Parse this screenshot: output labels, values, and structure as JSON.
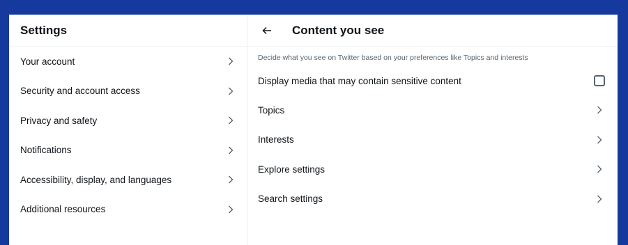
{
  "sidebar": {
    "title": "Settings",
    "items": [
      {
        "label": "Your account"
      },
      {
        "label": "Security and account access"
      },
      {
        "label": "Privacy and safety"
      },
      {
        "label": "Notifications"
      },
      {
        "label": "Accessibility, display, and languages"
      },
      {
        "label": "Additional resources"
      }
    ]
  },
  "main": {
    "title": "Content you see",
    "description": "Decide what you see on Twitter based on your preferences like Topics and interests",
    "sensitive_media": {
      "label": "Display media that may contain sensitive content",
      "checked": false
    },
    "rows": [
      {
        "label": "Topics"
      },
      {
        "label": "Interests"
      },
      {
        "label": "Explore settings"
      },
      {
        "label": "Search settings"
      }
    ]
  },
  "icons": {
    "back": "arrow-left-icon",
    "chevron": "chevron-right-icon",
    "checkbox": "checkbox-unchecked"
  },
  "colors": {
    "background": "#16399e",
    "panel": "#ffffff",
    "text": "#0f1419",
    "muted": "#536471",
    "divider": "#eff3f4"
  }
}
